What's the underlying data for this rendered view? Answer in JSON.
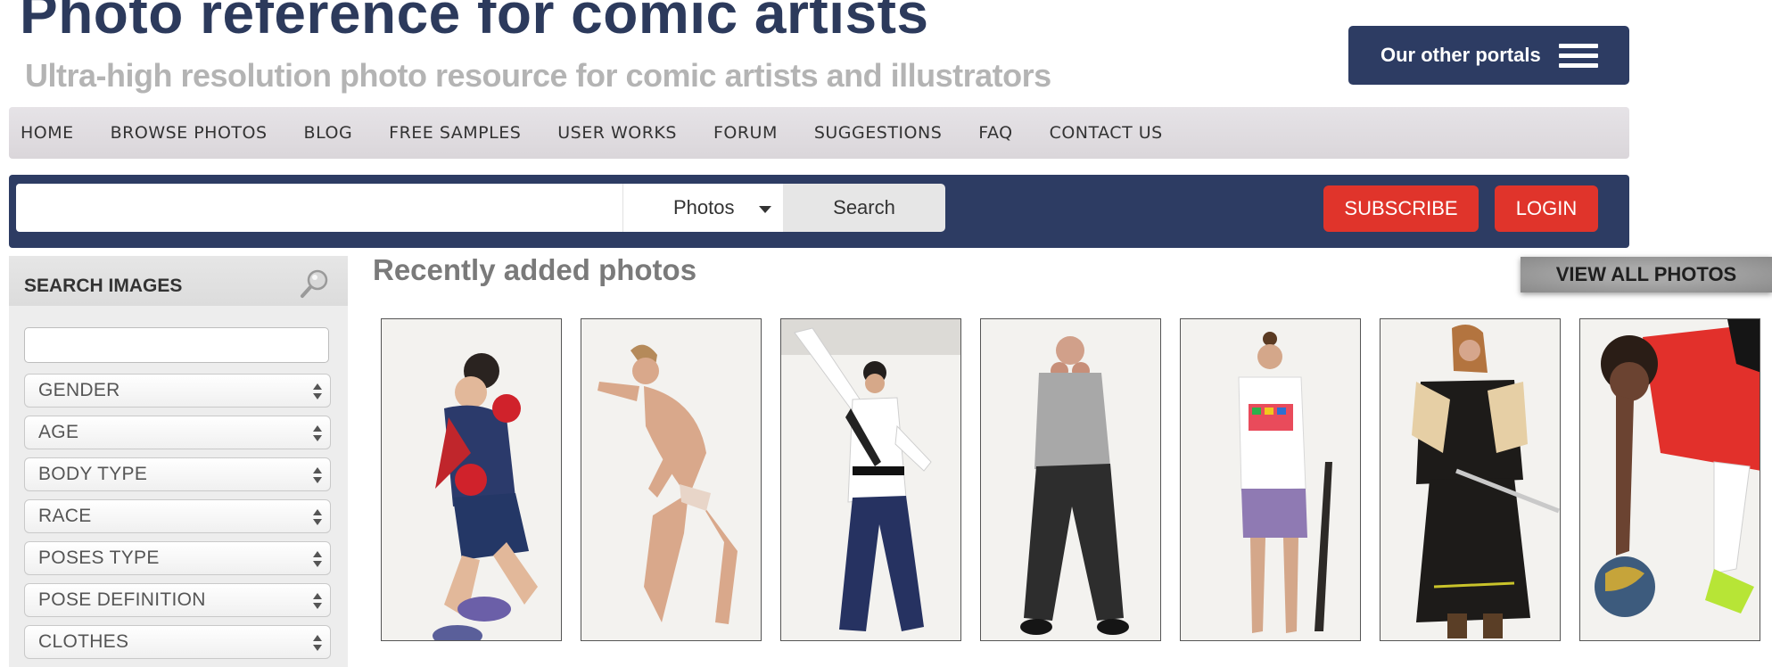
{
  "header": {
    "title": "Photo reference for comic artists",
    "subtitle": "Ultra-high resolution photo resource for comic artists and illustrators",
    "portals_label": "Our other portals"
  },
  "nav": {
    "items": [
      "HOME",
      "BROWSE PHOTOS",
      "BLOG",
      "FREE SAMPLES",
      "USER WORKS",
      "FORUM",
      "SUGGESTIONS",
      "FAQ",
      "CONTACT US"
    ]
  },
  "search": {
    "query": "",
    "type_selected": "Photos",
    "button_label": "Search",
    "subscribe_label": "SUBSCRIBE",
    "login_label": "LOGIN"
  },
  "sidebar": {
    "title": "SEARCH IMAGES",
    "input_value": "",
    "filters": [
      "GENDER",
      "AGE",
      "BODY TYPE",
      "RACE",
      "POSES TYPE",
      "POSE DEFINITION",
      "CLOTHES"
    ]
  },
  "main": {
    "section_title": "Recently added photos",
    "view_all_label": "VIEW ALL PHOTOS"
  },
  "colors": {
    "brand_navy": "#2d3c63",
    "accent_red": "#e0342b",
    "nav_bg": "#e1dde1",
    "title_blue": "#2c3a5c"
  }
}
